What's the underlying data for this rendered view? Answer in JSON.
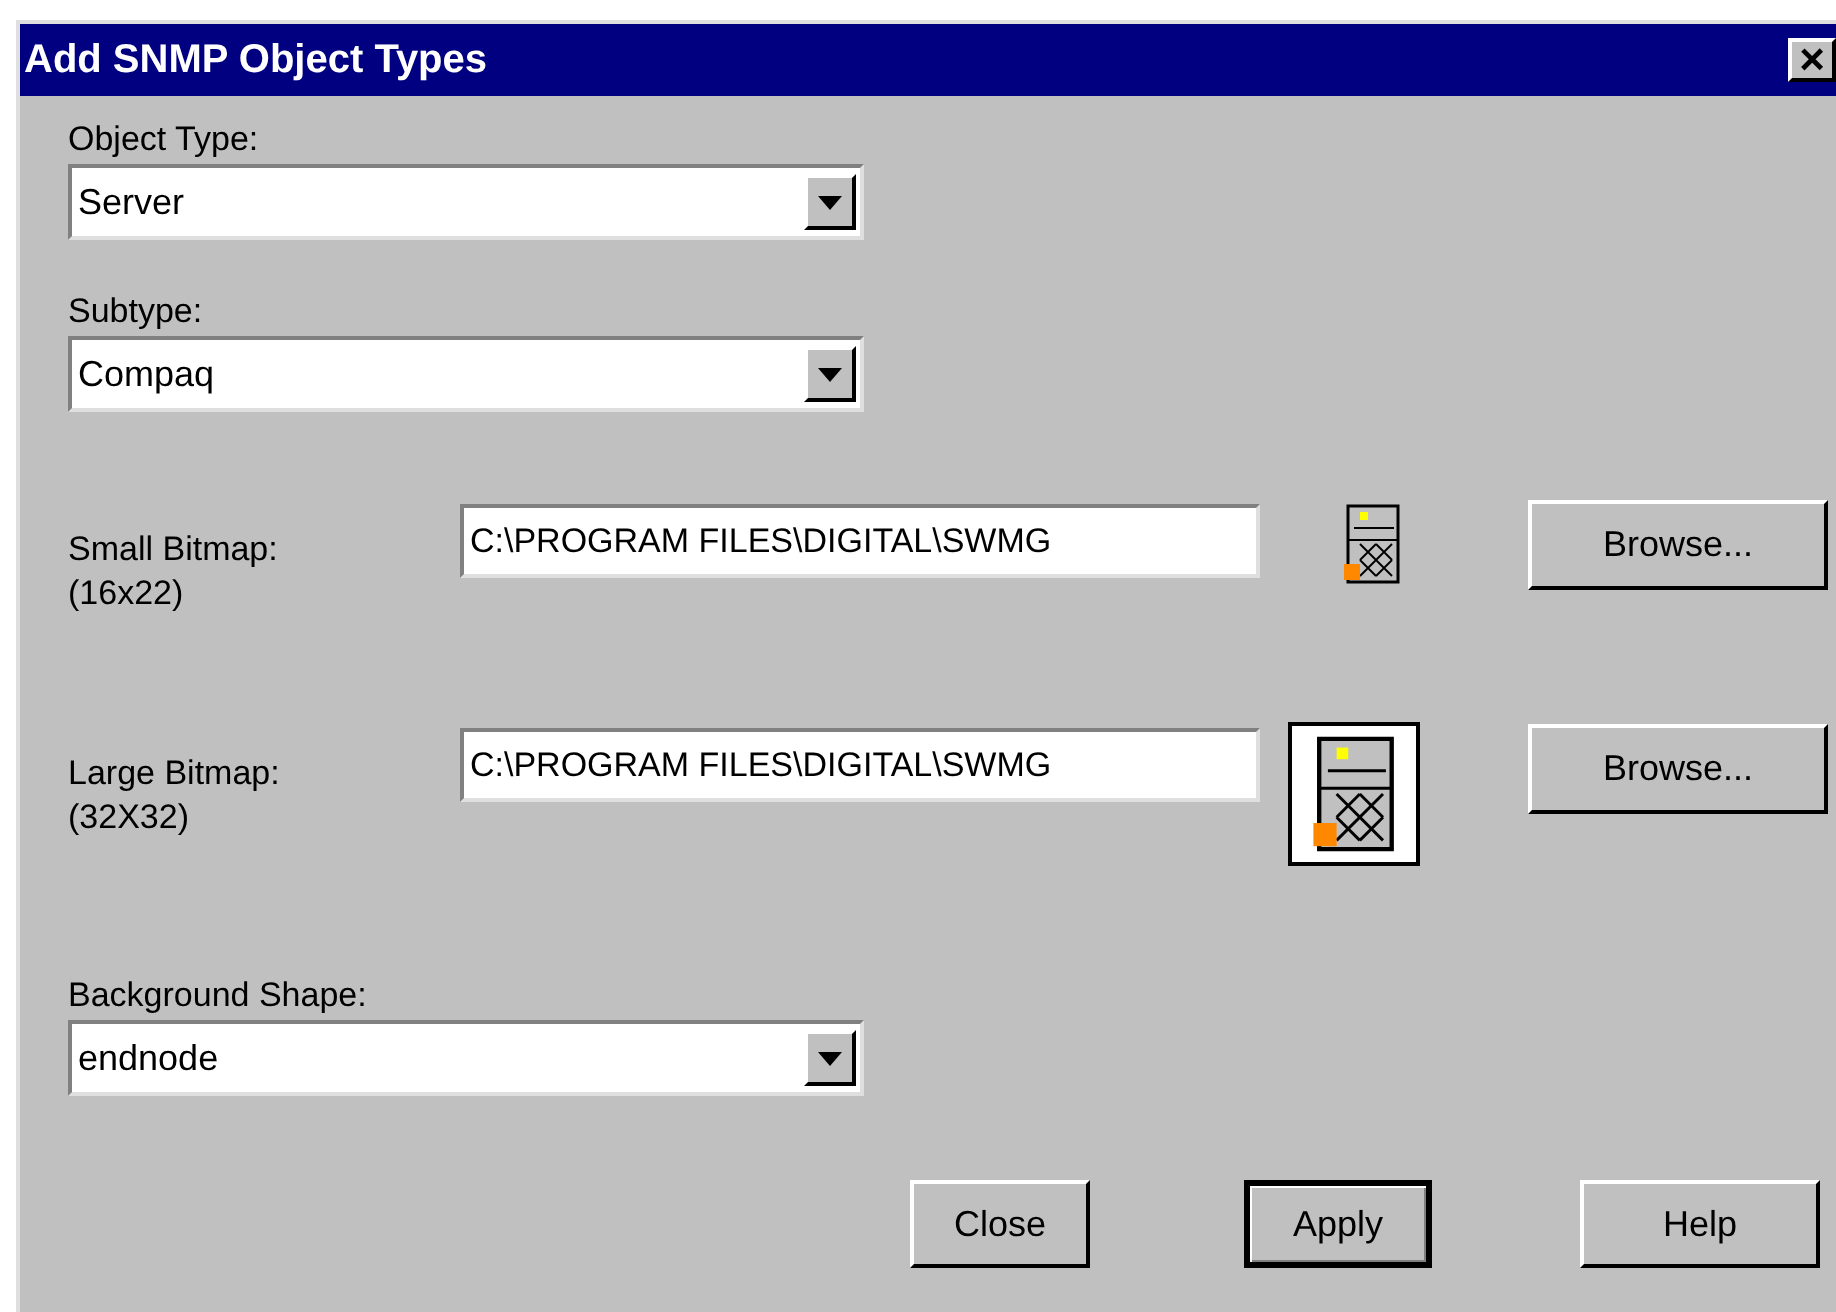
{
  "window": {
    "title": "Add SNMP Object Types",
    "close": "×"
  },
  "object_type": {
    "label": "Object Type:",
    "value": "Server"
  },
  "subtype": {
    "label": "Subtype:",
    "value": "Compaq"
  },
  "bitmaps": [
    {
      "label": "Small Bitmap:",
      "size": "(16x22)",
      "value": "C:\\PROGRAM FILES\\DIGITAL\\SWMG",
      "kind": "small",
      "button": "Browse..."
    },
    {
      "label": "Large Bitmap:",
      "size": "(32X32)",
      "value": "C:\\PROGRAM FILES\\DIGITAL\\SWMG",
      "kind": "large",
      "button": "Browse..."
    }
  ],
  "background_shape": {
    "label": "Background Shape:",
    "value": "endnode"
  },
  "buttons": [
    {
      "label": "Close",
      "default": false
    },
    {
      "label": "Apply",
      "default": true
    },
    {
      "label": "Help",
      "default": false
    }
  ]
}
